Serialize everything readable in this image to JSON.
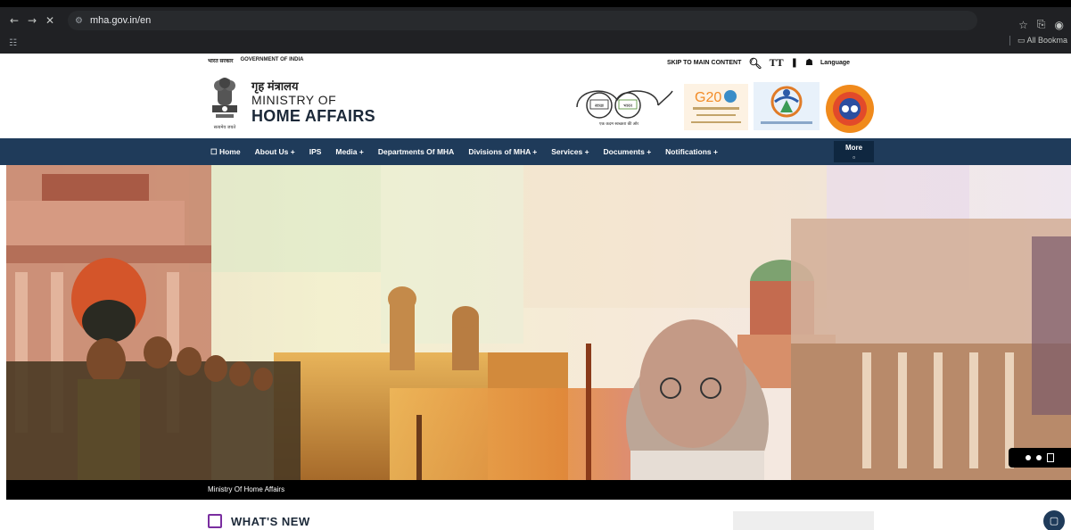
{
  "browser": {
    "url": "mha.gov.in/en",
    "site_info_icon": "tune-icon",
    "back": "←",
    "forward": "→",
    "stop": "✕",
    "bookmark_star": "☆",
    "extensions": "⎘",
    "all_bookmarks": "All Bookma",
    "apps": "☷"
  },
  "gov_strip": {
    "hindi": "भारत सरकार",
    "english": "GOVERNMENT OF INDIA",
    "skip": "SKIP TO MAIN CONTENT",
    "language": "Language"
  },
  "header": {
    "title_hindi": "गृह मंत्रालय",
    "title_ministry": "MINISTRY OF",
    "title_home": "HOME AFFAIRS",
    "emblem_caption": "सत्यमेव जयते",
    "swachh_left": "स्वच्छ",
    "swachh_right": "भारत",
    "swachh_tagline": "एक कदम स्वच्छता की ओर",
    "g20_text": "G20"
  },
  "nav": {
    "items": [
      "☐ Home",
      "About Us +",
      "IPS",
      "Media +",
      "Departments Of MHA",
      "Divisions of MHA +",
      "Services +",
      "Documents +",
      "Notifications +"
    ],
    "more": "More",
    "more_icon": "▫"
  },
  "hero": {
    "caption": "Ministry Of Home Affairs"
  },
  "whats_new": {
    "title": "WHAT'S NEW"
  },
  "colors": {
    "navbar": "#1f3b5a",
    "accent_purple": "#7a2ea0"
  }
}
